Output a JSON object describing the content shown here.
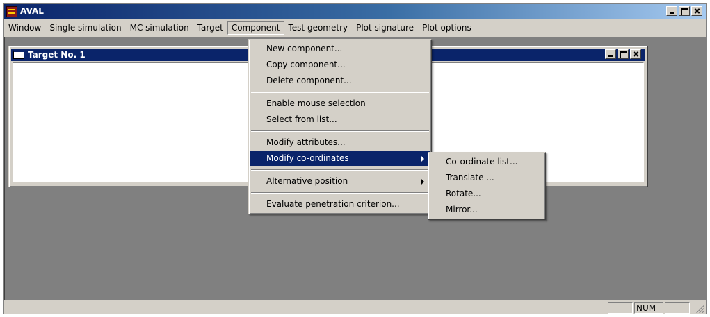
{
  "app": {
    "title": "AVAL"
  },
  "menubar": [
    "Window",
    "Single simulation",
    "MC simulation",
    "Target",
    "Component",
    "Test geometry",
    "Plot signature",
    "Plot options"
  ],
  "child_window": {
    "title": "Target No. 1"
  },
  "component_menu": {
    "items": [
      "New component...",
      "Copy component...",
      "Delete component...",
      "Enable mouse selection",
      "Select from list...",
      "Modify attributes...",
      "Modify co-ordinates",
      "Alternative position",
      "Evaluate penetration criterion..."
    ],
    "highlighted": "Modify co-ordinates"
  },
  "coordinates_submenu": {
    "items": [
      "Co-ordinate list...",
      "Translate ...",
      "Rotate...",
      "Mirror..."
    ]
  },
  "statusbar": {
    "num_indicator": "NUM"
  },
  "colors": {
    "titlebar": "#0a246a",
    "menu_bg": "#d4d0c8",
    "mdi_bg": "#808080",
    "highlight": "#0a246a"
  }
}
